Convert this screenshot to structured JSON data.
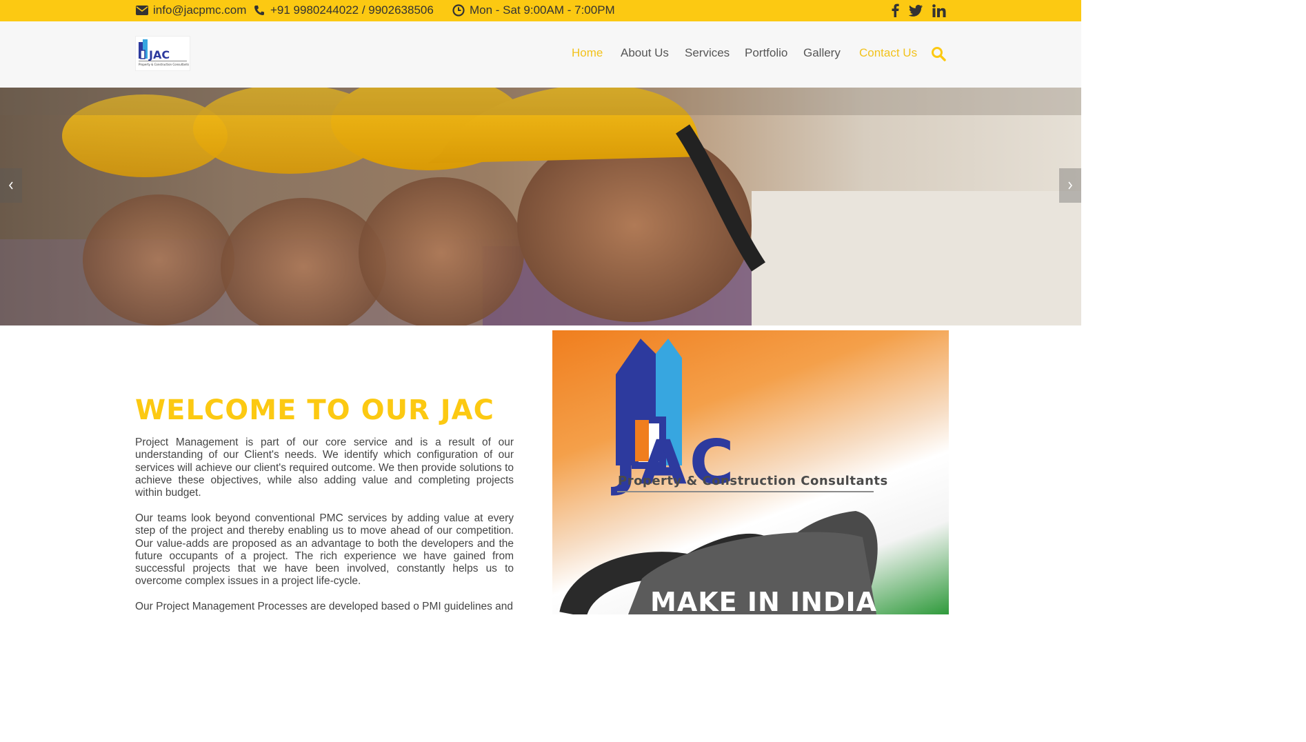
{
  "topbar": {
    "email": "info@jacpmc.com",
    "phone": "+91 9980244022 / 9902638506",
    "hours": "Mon - Sat 9:00AM - 7:00PM",
    "email_icon": "envelope-icon",
    "phone_icon": "phone-icon",
    "hours_icon": "clock-icon",
    "social": [
      "facebook-icon",
      "twitter-icon",
      "linkedin-icon"
    ],
    "bg_color": "#fcc912"
  },
  "header": {
    "logo_text": "JAC",
    "logo_tagline": "Property & Construction Consultants",
    "nav": {
      "home": "Home",
      "about": "About Us",
      "services": "Services",
      "portfolio": "Portfolio",
      "gallery": "Gallery",
      "contact": "Contact Us"
    },
    "accent_color": "#f2c21c"
  },
  "main": {
    "welcome_title": "WELCOME TO OUR JAC",
    "paragraphs": [
      "Project Management is part of our core service and is a result of our understanding of our Client's needs. We identify which configuration of our services will achieve our client's required outcome. We then provide solutions to achieve these objectives, while also adding value and completing projects within budget.",
      "Our teams look beyond conventional PMC services by adding value at every step of the project and thereby enabling us to move ahead of our competition. Our value-adds are proposed as an advantage to both the developers and the future occupants of a project. The rich experience we have gained from successful projects that we have been involved, constantly helps us to overcome complex issues in a project life-cycle.",
      "Our Project Management Processes are developed based o PMI guidelines and"
    ],
    "promo": {
      "title": "JAC",
      "subtitle": "Property & Construction Consultants",
      "slogan": "MAKE IN INDIA"
    }
  }
}
